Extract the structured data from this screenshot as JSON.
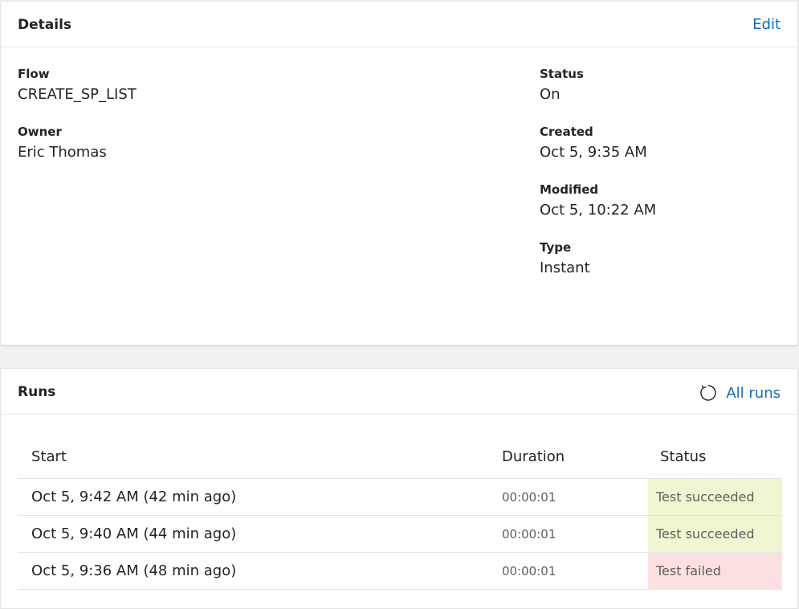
{
  "details": {
    "title": "Details",
    "edit_label": "Edit",
    "left_fields": [
      {
        "label": "Flow",
        "value": "CREATE_SP_LIST"
      },
      {
        "label": "Owner",
        "value": "Eric Thomas"
      }
    ],
    "right_fields": [
      {
        "label": "Status",
        "value": "On"
      },
      {
        "label": "Created",
        "value": "Oct 5, 9:35 AM"
      },
      {
        "label": "Modified",
        "value": "Oct 5, 10:22 AM"
      },
      {
        "label": "Type",
        "value": "Instant"
      }
    ]
  },
  "runs": {
    "title": "Runs",
    "all_runs_label": "All runs",
    "refresh_icon": "refresh-icon",
    "columns": {
      "start": "Start",
      "duration": "Duration",
      "status": "Status"
    },
    "rows": [
      {
        "start": "Oct 5, 9:42 AM (42 min ago)",
        "duration": "00:00:01",
        "status": "Test succeeded",
        "state": "succeeded"
      },
      {
        "start": "Oct 5, 9:40 AM (44 min ago)",
        "duration": "00:00:01",
        "status": "Test succeeded",
        "state": "succeeded"
      },
      {
        "start": "Oct 5, 9:36 AM (48 min ago)",
        "duration": "00:00:01",
        "status": "Test failed",
        "state": "failed"
      }
    ]
  },
  "colors": {
    "link": "#0f6cbd",
    "succeeded_bg": "#eff6d1",
    "failed_bg": "#fce0e1"
  }
}
